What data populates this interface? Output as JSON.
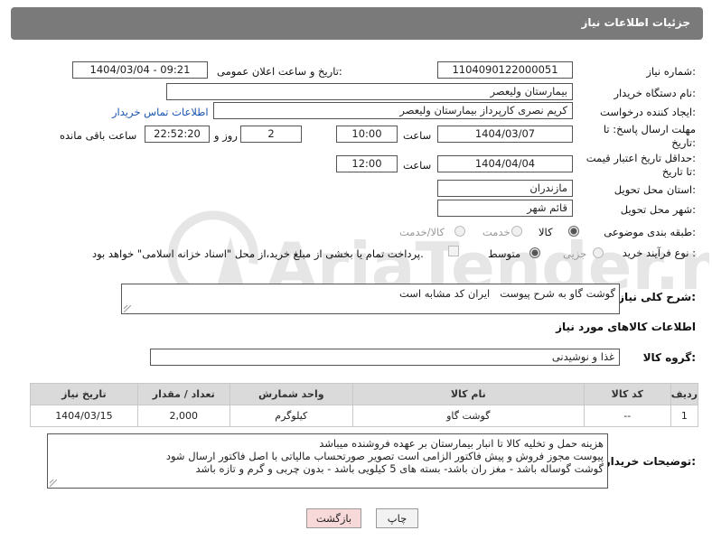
{
  "header": {
    "title": "جزئیات اطلاعات نیاز"
  },
  "form": {
    "need_number_label": "شماره نیاز:",
    "need_number": "1104090122000051",
    "announce_label": "تاریخ و ساعت اعلان عمومی:",
    "announce_value": "1404/03/04 - 09:21",
    "buyer_org_label": "نام دستگاه خریدار:",
    "buyer_org": "بیمارستان ولیعصر",
    "creator_label": "ایجاد کننده درخواست:",
    "creator": "کریم نصری کارپرداز بیمارستان ولیعصر",
    "contact_link": "اطلاعات تماس خریدار",
    "deadline_label_1": "مهلت ارسال پاسخ: تا",
    "deadline_label_2": "تاریخ:",
    "deadline_date": "1404/03/07",
    "time_label": "ساعت",
    "deadline_time": "10:00",
    "days_value": "2",
    "days_label": "روز و",
    "remaining_time": "22:52:20",
    "remaining_label": "ساعت باقی مانده",
    "price_validity_label_1": "حداقل تاریخ اعتبار قیمت:",
    "price_validity_label_2": "تا تاریخ:",
    "price_validity_date": "1404/04/04",
    "price_validity_time": "12:00",
    "province_label": "استان محل تحویل:",
    "province": "مازندران",
    "city_label": "شهر محل تحویل:",
    "city": "قائم شهر",
    "category_label": "طبقه بندی موضوعی:",
    "category_options": [
      "کالا",
      "خدمت",
      "کالا/خدمت"
    ],
    "category_selected": 0,
    "process_label": "نوع فرآیند خرید :",
    "process_options": [
      "جزیی",
      "متوسط"
    ],
    "process_selected": 1,
    "payment_note": "پرداخت تمام یا بخشی از مبلغ خرید،از محل \"اسناد خزانه اسلامی\" خواهد بود.",
    "summary_label": "شرح کلی نیاز:",
    "summary": "گوشت گاو به شرح پیوست   ایران کد مشابه است",
    "goods_section_title": "اطلاعات کالاهای مورد نیاز",
    "goods_group_label": "گروه کالا:",
    "goods_group": "غذا و نوشیدنی"
  },
  "table": {
    "headers": [
      "ردیف",
      "کد کالا",
      "نام کالا",
      "واحد شمارش",
      "تعداد / مقدار",
      "تاریخ نیاز"
    ],
    "rows": [
      [
        "1",
        "--",
        "گوشت گاو",
        "کیلوگرم",
        "2,000",
        "1404/03/15"
      ]
    ]
  },
  "buyer_notes": {
    "label": "توضیحات خریدار:",
    "lines": [
      "هزینه حمل و تخلیه کالا تا انبار بیمارستان بر عهده فروشنده میباشد",
      "پیوست مجوز فروش و پیش فاکتور الزامی است  تصویر صورتحساب مالیاتی با اصل فاکتور ارسال شود",
      "گوشت گوساله باشد - مغز ران باشد- بسته های 5 کیلویی باشد - بدون چربی و گرم و تازه باشد"
    ]
  },
  "buttons": {
    "print": "چاپ",
    "back": "بازگشت"
  },
  "watermark": {
    "text": "AriaTender.net"
  },
  "colors": {
    "header_bg": "#7a7a7a",
    "link": "#1a55b0",
    "back_btn_bg": "#f8d9d9",
    "watermark": "#e6e6e6"
  }
}
